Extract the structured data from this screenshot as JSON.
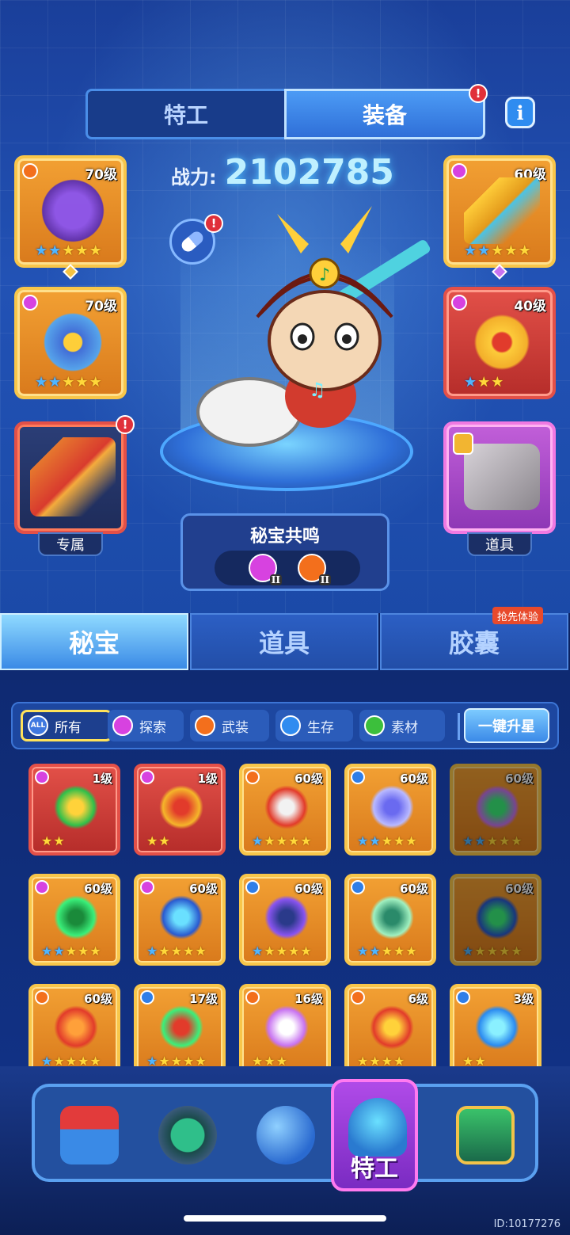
{
  "top_tabs": {
    "agent": "特工",
    "equipment": "装备"
  },
  "info_icon": "i",
  "power": {
    "label": "战力:",
    "value": "2102785"
  },
  "left_slots": [
    {
      "level": "70级",
      "type": "crown",
      "stars_blue": 2,
      "stars_gold": 3
    },
    {
      "level": "70级",
      "type": "explore",
      "stars_blue": 2,
      "stars_gold": 3
    },
    {
      "caption": "专属"
    }
  ],
  "right_slots": [
    {
      "level": "60级",
      "type": "explore",
      "stars_blue": 2,
      "stars_gold": 3
    },
    {
      "level": "40级",
      "type": "explore",
      "stars_blue": 1,
      "stars_gold": 2
    },
    {
      "caption": "道具"
    }
  ],
  "resonance": {
    "title": "秘宝共鸣",
    "roman": "II"
  },
  "category_tabs": [
    "秘宝",
    "道具",
    "胶囊"
  ],
  "trial_badge": "抢先体验",
  "filters": [
    {
      "icon": "ALL",
      "label": "所有"
    },
    {
      "icon": "",
      "label": "探索"
    },
    {
      "icon": "",
      "label": "武装"
    },
    {
      "icon": "",
      "label": "生存"
    },
    {
      "icon": "",
      "label": "素材"
    }
  ],
  "upstar_button": "一键升星",
  "items": [
    {
      "level": "1级",
      "type": "explore",
      "style": "red"
    },
    {
      "level": "1级",
      "type": "explore",
      "style": "red"
    },
    {
      "level": "60级",
      "type": "crown",
      "style": "gold"
    },
    {
      "level": "60级",
      "type": "shield",
      "style": "gold"
    },
    {
      "level": "60级",
      "type": "",
      "style": "dim"
    },
    {
      "level": "60级",
      "type": "explore",
      "style": "gold"
    },
    {
      "level": "60级",
      "type": "explore",
      "style": "gold"
    },
    {
      "level": "60级",
      "type": "shield",
      "style": "gold"
    },
    {
      "level": "60级",
      "type": "shield",
      "style": "gold"
    },
    {
      "level": "60级",
      "type": "",
      "style": "dim"
    },
    {
      "level": "60级",
      "type": "crown",
      "style": "gold"
    },
    {
      "level": "17级",
      "type": "shield",
      "style": "gold"
    },
    {
      "level": "16级",
      "type": "crown",
      "style": "gold"
    },
    {
      "level": "6级",
      "type": "crown",
      "style": "gold"
    },
    {
      "level": "3级",
      "type": "shield",
      "style": "gold"
    }
  ],
  "nav": {
    "active_label": "特工"
  },
  "device_id": "ID:10177276",
  "colors": {
    "gold_frame": "#f8c64a",
    "red_frame": "#e35048",
    "accent_blue": "#2f8cf0",
    "active_nav": "#b04be8"
  }
}
